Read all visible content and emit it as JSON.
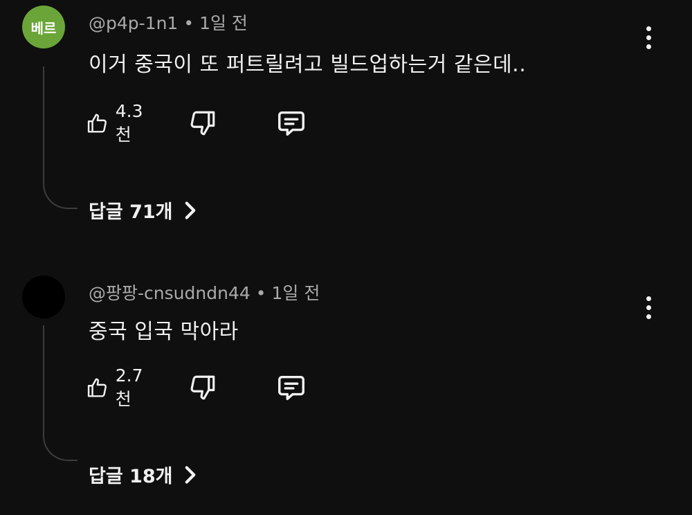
{
  "comments": [
    {
      "avatar_text": "베르",
      "avatar_color": "#6ba539",
      "username": "@p4p-1n1",
      "separator": "•",
      "time": "1일 전",
      "text": "이거 중국이 또 퍼트릴려고 빌드업하는거 같은데..",
      "likes": "4.3천",
      "replies": "답글 71개"
    },
    {
      "avatar_text": "",
      "avatar_color": "#000000",
      "username": "@팡팡-cnsudndn44",
      "separator": "•",
      "time": "1일 전",
      "text": "중국 입국 막아라",
      "likes": "2.7천",
      "replies": "답글 18개"
    }
  ],
  "icons": {
    "like": "thumbs-up-icon",
    "dislike": "thumbs-down-icon",
    "reply": "comment-icon",
    "more": "more-vertical-icon",
    "expand": "chevron-right-icon"
  }
}
